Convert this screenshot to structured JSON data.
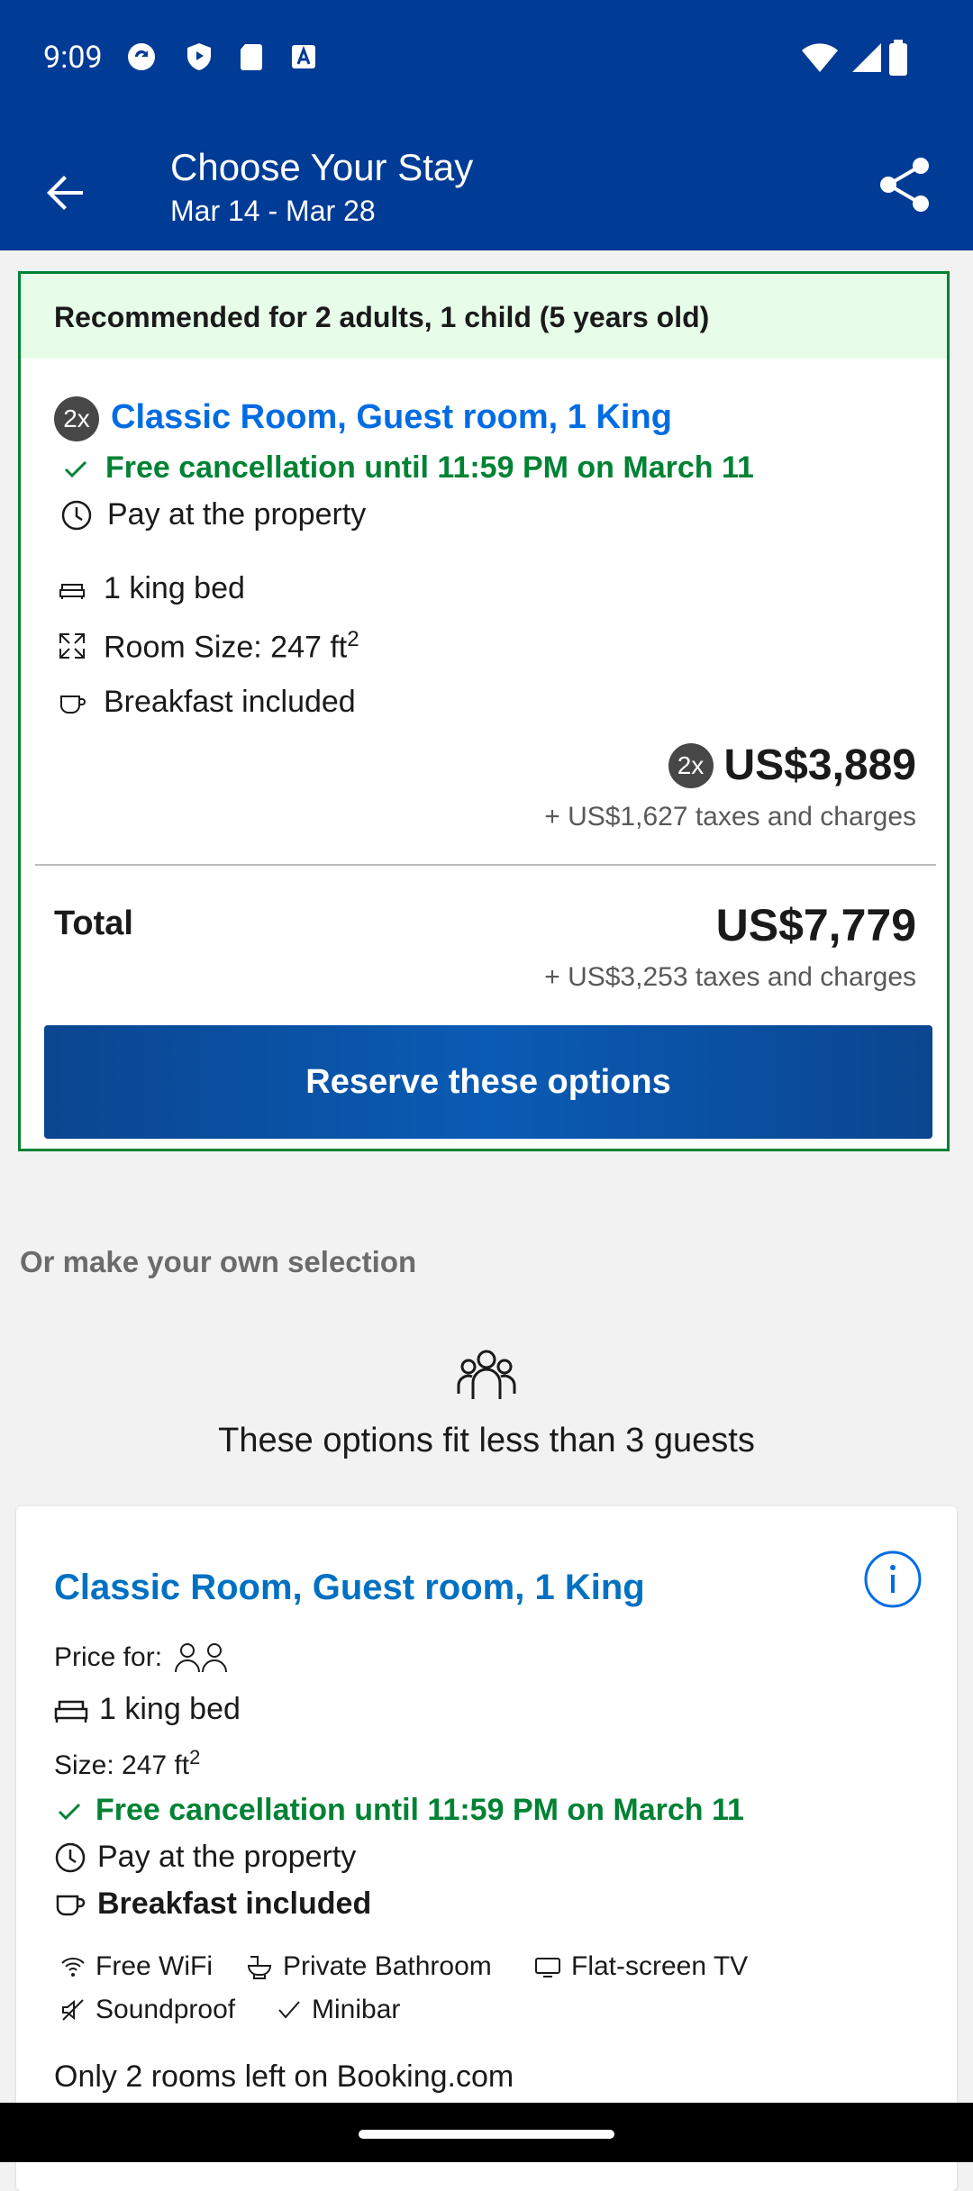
{
  "status": {
    "time": "9:09"
  },
  "header": {
    "title": "Choose Your Stay",
    "subtitle": "Mar 14 - Mar 28"
  },
  "recommended": {
    "heading": "Recommended for 2 adults, 1 child (5 years old)",
    "qty": "2x",
    "room_title": "Classic Room, Guest room, 1 King",
    "cancellation": "Free cancellation until 11:59 PM on March 11",
    "payment": "Pay at the property",
    "bed": "1 king bed",
    "size_label": "Room Size: 247 ft",
    "size_exp": "2",
    "breakfast": "Breakfast included",
    "price_qty": "2x",
    "price": "US$3,889",
    "taxes": "+ US$1,627 taxes and charges",
    "total_label": "Total",
    "total_price": "US$7,779",
    "total_taxes": "+ US$3,253 taxes and charges",
    "reserve_label": "Reserve these options"
  },
  "section": {
    "title": "Or make your own selection",
    "guests_note": "These options fit less than 3 guests"
  },
  "option": {
    "title": "Classic Room, Guest room, 1 King",
    "price_for_label": "Price for:",
    "bed": "1 king bed",
    "size_label": "Size:",
    "size_value": "247 ft",
    "size_exp": "2",
    "cancellation": "Free cancellation until 11:59 PM on March 11",
    "payment": "Pay at the property",
    "breakfast": "Breakfast included",
    "facilities": [
      "Free WiFi",
      "Private Bathroom",
      "Flat-screen TV",
      "Soundproof",
      "Minibar"
    ],
    "availability": "Only 2 rooms left on Booking.com"
  },
  "colors": {
    "brand": "#003b95",
    "accent_blue": "#006ce4",
    "green": "#008234",
    "button": "#0a4fa0"
  }
}
